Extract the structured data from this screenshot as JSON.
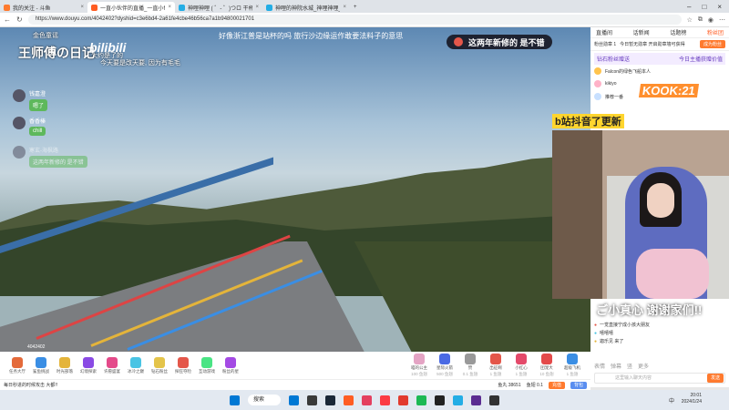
{
  "browser": {
    "tabs": [
      {
        "label": "我的关注 - 斗鱼",
        "color": "#ff7a2e",
        "active": false
      },
      {
        "label": "一直小伙伴的直播_一直小伙伴的...",
        "color": "#ff5d23",
        "active": true
      },
      {
        "label": "神哩神哩 ( ゜- ゜)つロ 干杯~-bilibili",
        "color": "#23ade5",
        "active": false
      },
      {
        "label": "神哩的神院水城_神哩神哩_bilibili",
        "color": "#23ade5",
        "active": false
      }
    ],
    "new_tab": "+",
    "url": "https://www.douyu.com/4042402?dyshid=c3e6bd4-2a61fe4cbe46b56ca7a1b94800021701"
  },
  "video": {
    "title": "王师傅の日记",
    "logo": "bilibili",
    "overlay_top": "好像浙江普是站杯的吗  旅行沙边缘运作敢要法料子的意思",
    "overlay_sub1": "金色童谣",
    "overlay_sub2": "大约是了的",
    "overlay_sub3": "今天要是改天要, 因为有毛毛",
    "banner": "这两年新修的 是不错",
    "counter": "4042402",
    "chat": [
      {
        "name": "钱嘉澄",
        "bubble": "嗯了"
      },
      {
        "name": "香香榛",
        "bubble": "chill"
      },
      {
        "name": "寒玄-海枫路",
        "bubble": "这两年新修的 是不错"
      }
    ]
  },
  "sidebar": {
    "tabs": [
      "直播间",
      "话新闻",
      "话题榜",
      "粉丝团"
    ],
    "active_tab": "粉丝团",
    "rank_label": "粉丝勋章 1",
    "rank_text": "今日暂无勋章 开启勋章墙可获得",
    "rank_button": "成为粉丝",
    "fan_header": "钻石粉丝赠送",
    "fan_header_right": "今日主播获赠价值",
    "fans": [
      {
        "name": "Falcon的绿色飞船本人",
        "color": "#ffc44d"
      },
      {
        "name": "kikiyo",
        "color": "#ffb2c8"
      },
      {
        "name": "推荐一番",
        "color": "#c8e0ff"
      }
    ]
  },
  "webcam": {
    "banner": "b站抖音了更新",
    "kook": "KOOK:21",
    "thanks": "ご小真心 谢谢家们!!"
  },
  "sidechat": {
    "lines": [
      "一觉直接宁成小孩大朋友",
      "嘻嘻嘻",
      "迦乐见 来了"
    ]
  },
  "chatbox": {
    "tools": [
      "表情",
      "弹幕",
      "竖",
      "更多"
    ],
    "placeholder": "这里输入聊天内容",
    "send": "发送"
  },
  "gifts": [
    {
      "label": "任务大厅",
      "color": "#e46a3a"
    },
    {
      "label": "鲨鱼挑战",
      "color": "#3a8ee4"
    },
    {
      "label": "时光部落",
      "color": "#e4b43a"
    },
    {
      "label": "幻境探索",
      "color": "#8a4ae4"
    },
    {
      "label": "许愿盛宴",
      "color": "#e44a8a"
    },
    {
      "label": "冰冷之巅",
      "color": "#4ac4e4"
    },
    {
      "label": "钻石粉丝",
      "color": "#e4c44a"
    },
    {
      "label": "探狂夺险",
      "color": "#e4574a"
    },
    {
      "label": "互动游戏",
      "color": "#4ae484"
    },
    {
      "label": "粉丝的星",
      "color": "#a44ae4"
    }
  ],
  "gifts_right": [
    {
      "label": "喵的公主",
      "price": "100 鱼翅",
      "color": "#e4a4c4"
    },
    {
      "label": "星际火箭",
      "price": "500 鱼翅",
      "color": "#4a6ae4"
    },
    {
      "label": "赞",
      "price": "0.1 鱼翅",
      "color": "#999"
    },
    {
      "label": "出征啊",
      "price": "1 鱼翅",
      "color": "#e4574a"
    },
    {
      "label": "小红心",
      "price": "1 鱼翅",
      "color": "#e44a6a"
    },
    {
      "label": "团宠大",
      "price": "10 鱼翅",
      "color": "#e44a4a"
    },
    {
      "label": "超级飞机",
      "price": "1 鱼翅",
      "color": "#3a8ee4"
    }
  ],
  "balance": {
    "left": "每日秒进的时候攻击 大都!!",
    "fish": "鱼丸 38651",
    "fin": "鱼翅 0.1",
    "charge": "充值",
    "bag": "背包"
  },
  "taskbar": {
    "search": "搜索",
    "icons": [
      "#0078d4",
      "#3a3a3a",
      "#1b2838",
      "#ff5d23",
      "#e4405f",
      "#fc3c44",
      "#e23b2e",
      "#1db954",
      "#222",
      "#23ade5",
      "#5c2d91",
      "#333"
    ],
    "tray": "中",
    "time": "20:01",
    "date": "2024/1/24"
  }
}
